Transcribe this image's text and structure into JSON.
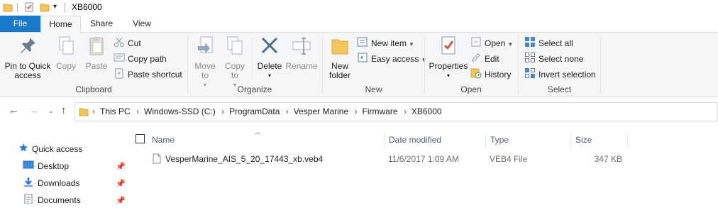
{
  "window": {
    "title": "XB6000"
  },
  "tabs": {
    "file": "File",
    "home": "Home",
    "share": "Share",
    "view": "View"
  },
  "ribbon": {
    "clipboard": {
      "label": "Clipboard",
      "pin_label": "Pin to Quick access",
      "copy_label": "Copy",
      "paste_label": "Paste",
      "cut_label": "Cut",
      "copy_path_label": "Copy path",
      "paste_shortcut_label": "Paste shortcut"
    },
    "organize": {
      "label": "Organize",
      "move_to_label": "Move to",
      "copy_to_label": "Copy to",
      "delete_label": "Delete",
      "rename_label": "Rename"
    },
    "new": {
      "label": "New",
      "new_folder_label": "New folder",
      "new_item_label": "New item",
      "easy_access_label": "Easy access"
    },
    "open": {
      "label": "Open",
      "properties_label": "Properties",
      "open_label": "Open",
      "edit_label": "Edit",
      "history_label": "History"
    },
    "select": {
      "label": "Select",
      "select_all_label": "Select all",
      "select_none_label": "Select none",
      "invert_selection_label": "Invert selection"
    }
  },
  "address": {
    "crumbs": [
      "This PC",
      "Windows-SSD (C:)",
      "ProgramData",
      "Vesper Marine",
      "Firmware",
      "XB6000"
    ]
  },
  "nav": {
    "items": [
      {
        "label": "Quick access",
        "icon": "star-icon"
      },
      {
        "label": "Desktop",
        "icon": "desktop-folder-icon",
        "pinned": true
      },
      {
        "label": "Downloads",
        "icon": "downloads-folder-icon",
        "pinned": true
      },
      {
        "label": "Documents",
        "icon": "documents-folder-icon",
        "pinned": true
      }
    ]
  },
  "files": {
    "columns": {
      "name": "Name",
      "date": "Date modified",
      "type": "Type",
      "size": "Size"
    },
    "rows": [
      {
        "name": "VesperMarine_AIS_5_20_17443_xb.veb4",
        "date": "11/6/2017 1:09 AM",
        "type": "VEB4 File",
        "size": "347 KB"
      }
    ]
  },
  "colors": {
    "accent": "#1979ca",
    "ribbon_bg": "#f5f6f7",
    "folder": "#f4c75a"
  }
}
